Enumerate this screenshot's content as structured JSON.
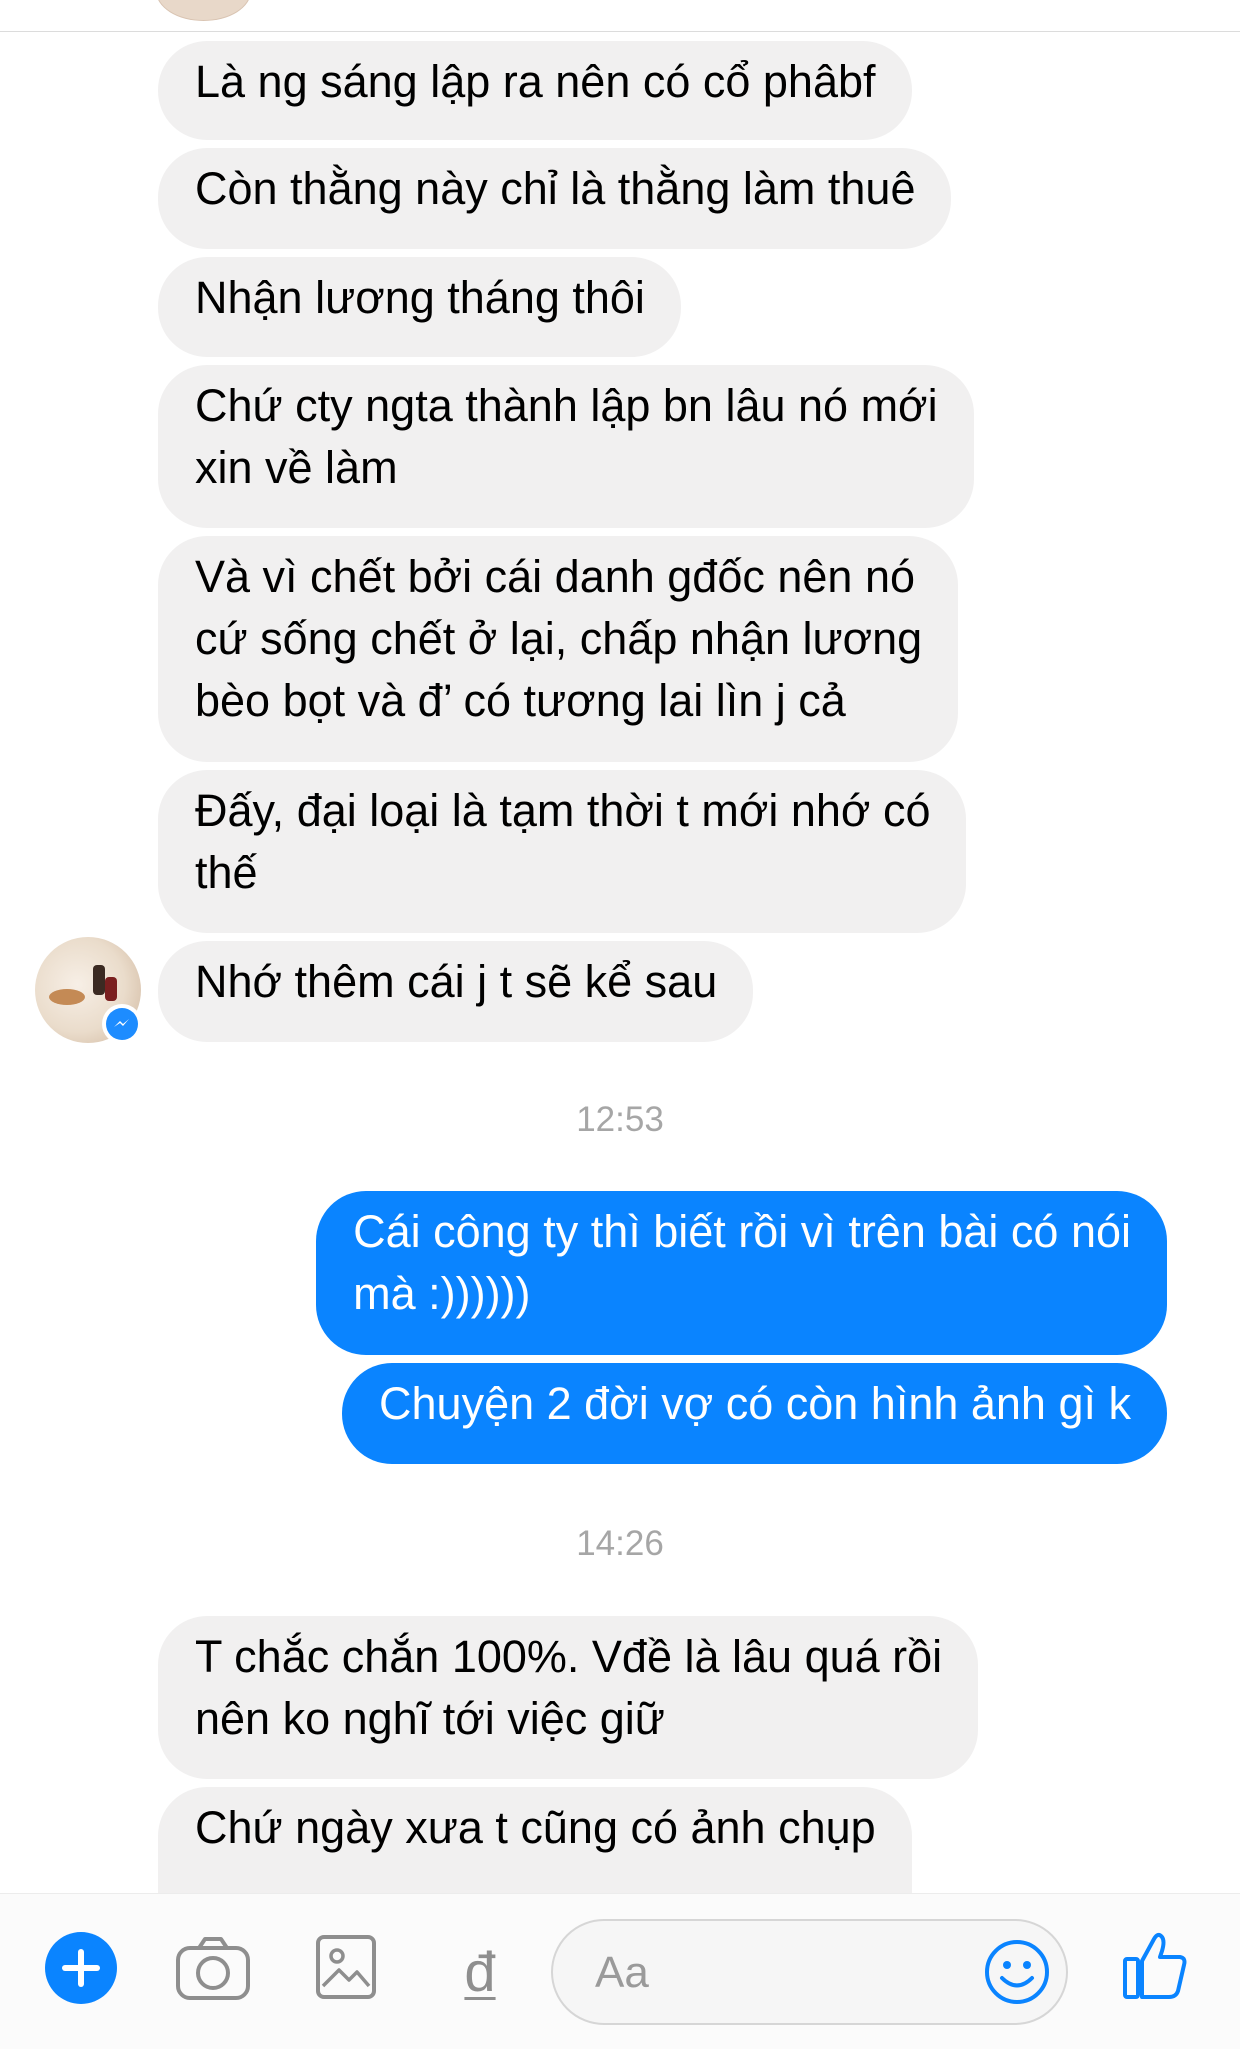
{
  "incoming_messages_1": [
    "Là ng sáng lập ra nên có cổ phâbf",
    "Còn thằng này chỉ là thằng làm thuê",
    "Nhận lương tháng thôi",
    "Chứ cty ngta thành lập bn lâu nó mới",
    "xin về làm",
    "Và vì chết bởi cái danh gđốc nên nó",
    "cứ sống chết ở lại, chấp nhận lương",
    "bèo bọt và đ’ có tương lai lìn j cả",
    "Đấy, đại loại là tạm thời t mới nhớ có",
    "thế",
    "Nhớ thêm cái j t sẽ kể sau"
  ],
  "timestamp_1": "12:53",
  "outgoing_messages": [
    "Cái công ty thì biết rồi vì trên bài có nói",
    "mà :))))))",
    "Chuyện 2 đời vợ có còn hình ảnh gì k"
  ],
  "timestamp_2": "14:26",
  "incoming_messages_2": [
    "T chắc chắn 100%. Vđề là lâu quá rồi",
    "nên ko nghĩ tới việc giữ",
    "Chứ ngày xưa t cũng có ảnh chụp"
  ],
  "composer": {
    "placeholder": "Aa",
    "d_glyph": "đ",
    "icons": [
      "plus-icon",
      "camera-icon",
      "gallery-icon",
      "d-stroke-icon",
      "emoji-icon",
      "thumbs-up-icon"
    ]
  },
  "colors": {
    "outgoing_bubble": "#0a84ff",
    "incoming_bubble": "#f1f0f0",
    "accent": "#1d8cff"
  }
}
